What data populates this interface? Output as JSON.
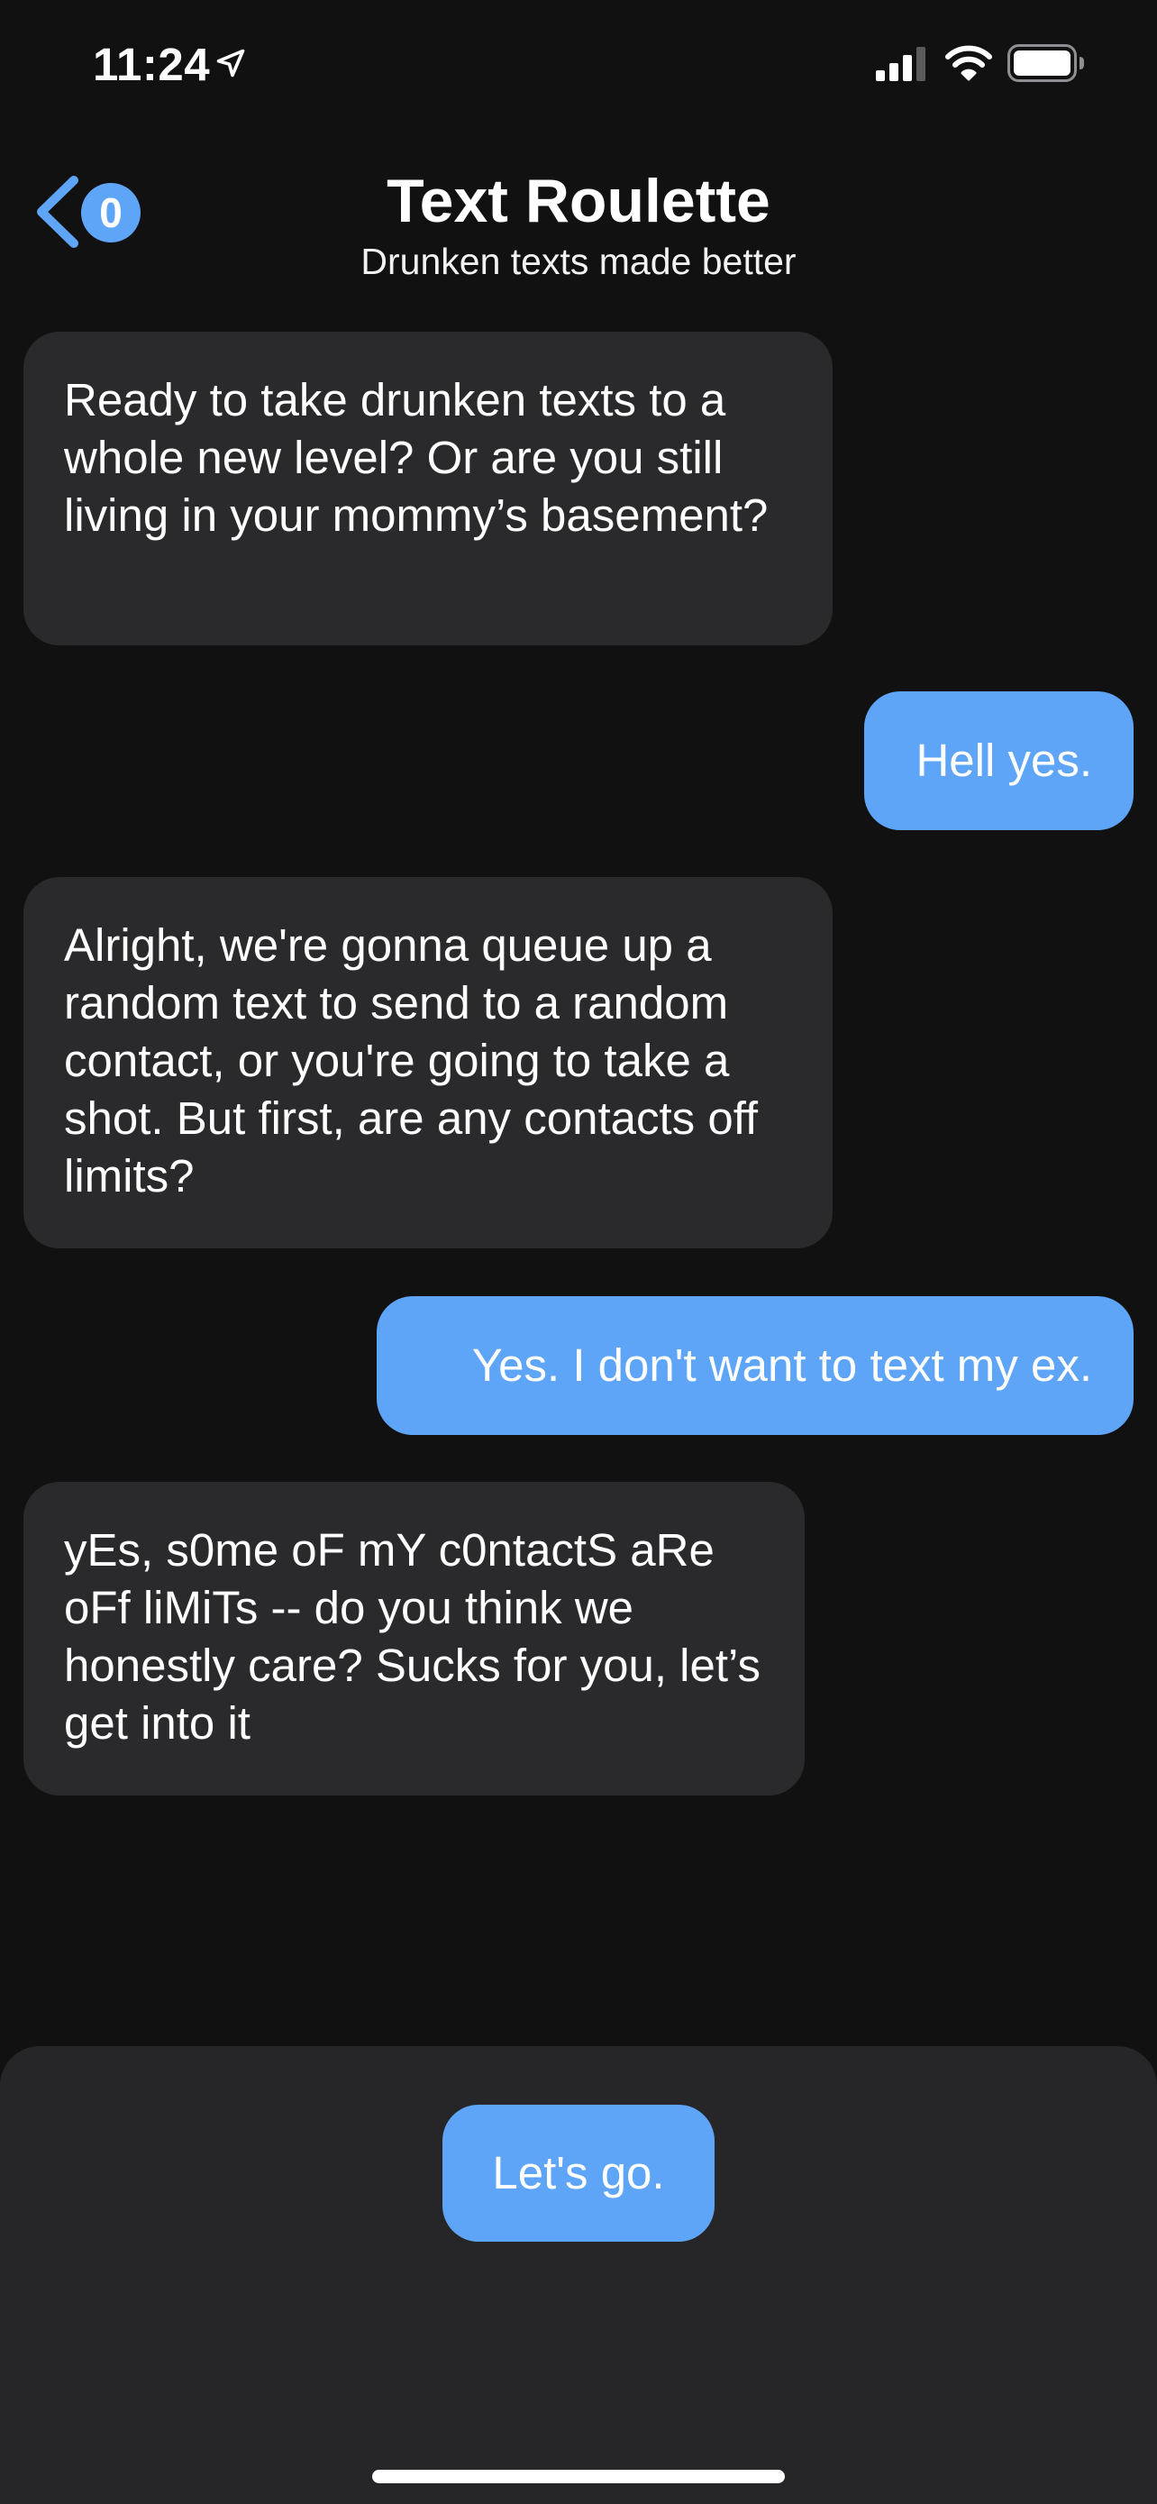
{
  "status_bar": {
    "time": "11:24",
    "icons": [
      "location-arrow-icon",
      "cellular-signal-icon",
      "wifi-icon",
      "battery-icon"
    ]
  },
  "header": {
    "back_icon": "chevron-left-icon",
    "badge_count": "0",
    "title": "Text Roulette",
    "subtitle": "Drunken texts made better"
  },
  "messages": [
    {
      "sender": "bot",
      "text": "Ready to take drunken texts to a whole new level? Or are you still living in your mommy’s basement?"
    },
    {
      "sender": "user",
      "text": "Hell yes."
    },
    {
      "sender": "bot",
      "text": "Alright, we're gonna queue up a random text to send to a random contact, or you're going to take a shot. But first, are any contacts off limits?"
    },
    {
      "sender": "user",
      "text": "Yes. I don't want to text my ex."
    },
    {
      "sender": "bot",
      "text": "yEs, s0me oF mY c0ntactS aRe oFf liMiTs -- do you think we honestly care? Sucks for you, let’s get into it"
    }
  ],
  "action": {
    "go_label": "Let's go."
  },
  "colors": {
    "background": "#111112",
    "incoming_bubble": "#2a2a2c",
    "outgoing_bubble": "#5fa5f7",
    "bottom_panel": "#262628",
    "accent": "#5fa5f7"
  }
}
